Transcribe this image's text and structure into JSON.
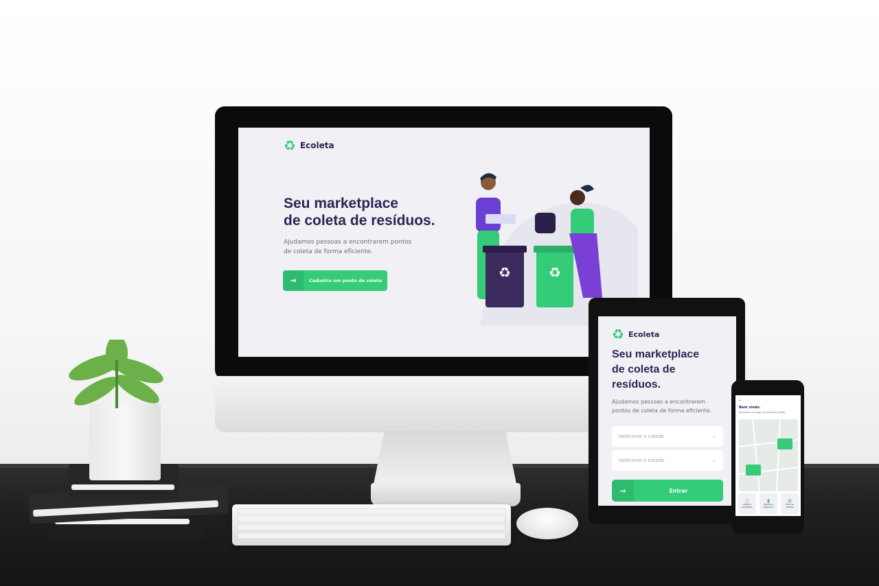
{
  "desktop": {
    "logo_text": "Ecoleta",
    "title_line1": "Seu marketplace",
    "title_line2": "de coleta de resíduos.",
    "description_line1": "Ajudamos pessoas a encontrarem pontos",
    "description_line2": "de coleta de forma eficiente.",
    "cta_label": "Cadastre um ponto de coleta"
  },
  "tablet": {
    "logo_text": "Ecoleta",
    "title_line1": "Seu marketplace",
    "title_line2": "de coleta de",
    "title_line3": "resíduos.",
    "description_line1": "Ajudamos pessoas a encontrarem",
    "description_line2": "pontos de coleta de forma eficiente.",
    "select_city_placeholder": "Selecione a cidade",
    "select_state_placeholder": "Selecione o estado",
    "enter_label": "Entrar"
  },
  "phone": {
    "back_icon": "arrow-left-icon",
    "greeting": "Bem vindo.",
    "subtitle": "Encontre no mapa um ponto de coleta.",
    "items": [
      {
        "icon": "lamp-icon",
        "line1": "Pilhas e",
        "line2": "Lâmpadas"
      },
      {
        "icon": "battery-icon",
        "line1": "Resíduos",
        "line2": "Orgânicos"
      },
      {
        "icon": "oil-icon",
        "line1": "Óleo de",
        "line2": "Cozinha"
      }
    ]
  },
  "colors": {
    "brand_green": "#34cb79",
    "brand_purple": "#322153",
    "text_muted": "#6c6c80",
    "screen_bg": "#f0f0f5"
  }
}
